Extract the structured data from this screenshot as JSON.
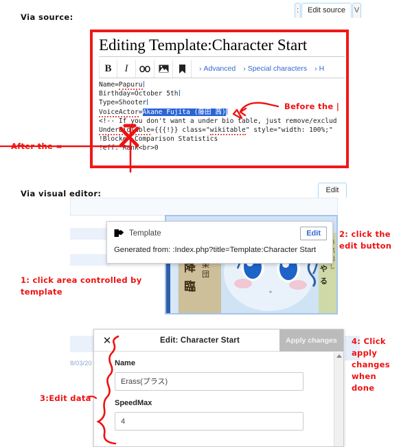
{
  "labels": {
    "via_source": "Via source:",
    "via_visual_editor": "Via visual editor:"
  },
  "top_tabs": {
    "left_partial": ":",
    "edit_source": "Edit source",
    "right_partial": "V"
  },
  "source_editor": {
    "page_title": "Editing Template:Character Start",
    "toolbar": {
      "bold": "B",
      "italic": "I",
      "link_icon": "link-icon",
      "image_icon": "image-icon",
      "cite_icon": "cite-icon",
      "advanced": "Advanced",
      "special_characters": "Special characters",
      "help_truncated": "H"
    },
    "code_lines": [
      "Name=Papuru",
      "Birthday=October 5th",
      "Type=Shooter",
      "VoiceActor=Akane Fujita (藤田 茜)",
      "<!-- If you don't want a under bio table, just remove/exclud",
      "UnderBioTable={{{!}} class=\"wikitable\" style=\"width: 100%;\"",
      "!Blocker Comparison Statistics",
      "!eff. Rank<br>0"
    ],
    "selected_text": "Akane Fujita (藤田 茜)",
    "line4_prefix": "VoiceActor=",
    "line5_parts": {
      "a": "<!-- If ",
      "b": "you",
      "c": " don't want a under bio table, just remove/exclud"
    },
    "line6_parts": {
      "a": "UnderBioTable=",
      "b": "{{{!}} class=",
      "c": "wikitable",
      "d": " style=",
      "e": "\"width: 100%;\""
    }
  },
  "visual_editor": {
    "edit_tab": "Edit",
    "template_popup": {
      "icon": "puzzle-template-icon",
      "label": "Template",
      "edit_button": "Edit",
      "generated_from": "Generated from: :Index.php?title=Template:Character Start"
    }
  },
  "edit_dialog": {
    "close_icon": "close-icon",
    "title": "Edit: Character Start",
    "apply_button": "Apply changes",
    "fields": [
      {
        "label": "Name",
        "value": "Erass(プラス)"
      },
      {
        "label": "SpeedMax",
        "value": "4"
      }
    ],
    "behind_text": "8/03/20"
  },
  "annotations": {
    "before_the_pipe": "Before the |",
    "after_the_equals": "After the =",
    "step1": "1: click area controlled by\ntemplate",
    "step2": "2: click the\nedit button",
    "step3": "3:Edit data",
    "step4": "4: Click apply\nchanges when\ndone"
  },
  "colors": {
    "annotation_red": "#ee1111",
    "border_red": "#f01818",
    "link_blue": "#3366cc",
    "selection_blue": "#2a65d8",
    "ve_selection_fill": "#d3e3f7"
  }
}
